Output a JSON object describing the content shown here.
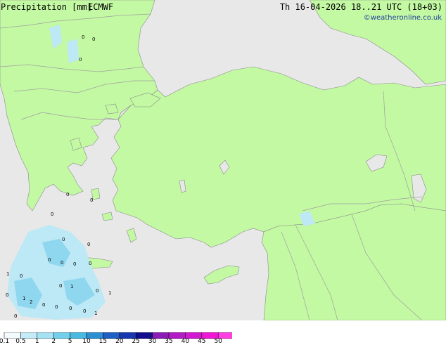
{
  "map": {
    "colors": {
      "land": "#c3f9a3",
      "sea": "#e8e8e8",
      "coast": "#8a8a8a",
      "border": "#a0a0a0",
      "precip_light": "#bde8f5",
      "precip_med": "#8fd6ef"
    },
    "precip_labels": [
      "0",
      "0",
      "0",
      "0",
      "0",
      "0",
      "0",
      "0",
      "0",
      "0",
      "0",
      "0",
      "0",
      "1",
      "1",
      "0",
      "0",
      "1",
      "0",
      "1",
      "0",
      "2",
      "0",
      "0",
      "0",
      "0",
      "1"
    ]
  },
  "legend": {
    "title": "Precipitation [mm]",
    "model": "ECMWF",
    "valid_time": "Th 16-04-2026 18..21 UTC (18+03)",
    "credit": "©weatheronline.co.uk",
    "ticks": [
      "0.1",
      "0.5",
      "1",
      "2",
      "5",
      "10",
      "15",
      "20",
      "25",
      "30",
      "35",
      "40",
      "45",
      "50"
    ],
    "colors": [
      "#f4fbfe",
      "#c4ecf7",
      "#a5e2f4",
      "#74cfeb",
      "#4ab9e1",
      "#2b8fd1",
      "#1e5fc4",
      "#1937ae",
      "#120d8c",
      "#8a1cb5",
      "#b21cc7",
      "#d21ad1",
      "#ee18d5",
      "#ff3fe2"
    ]
  }
}
